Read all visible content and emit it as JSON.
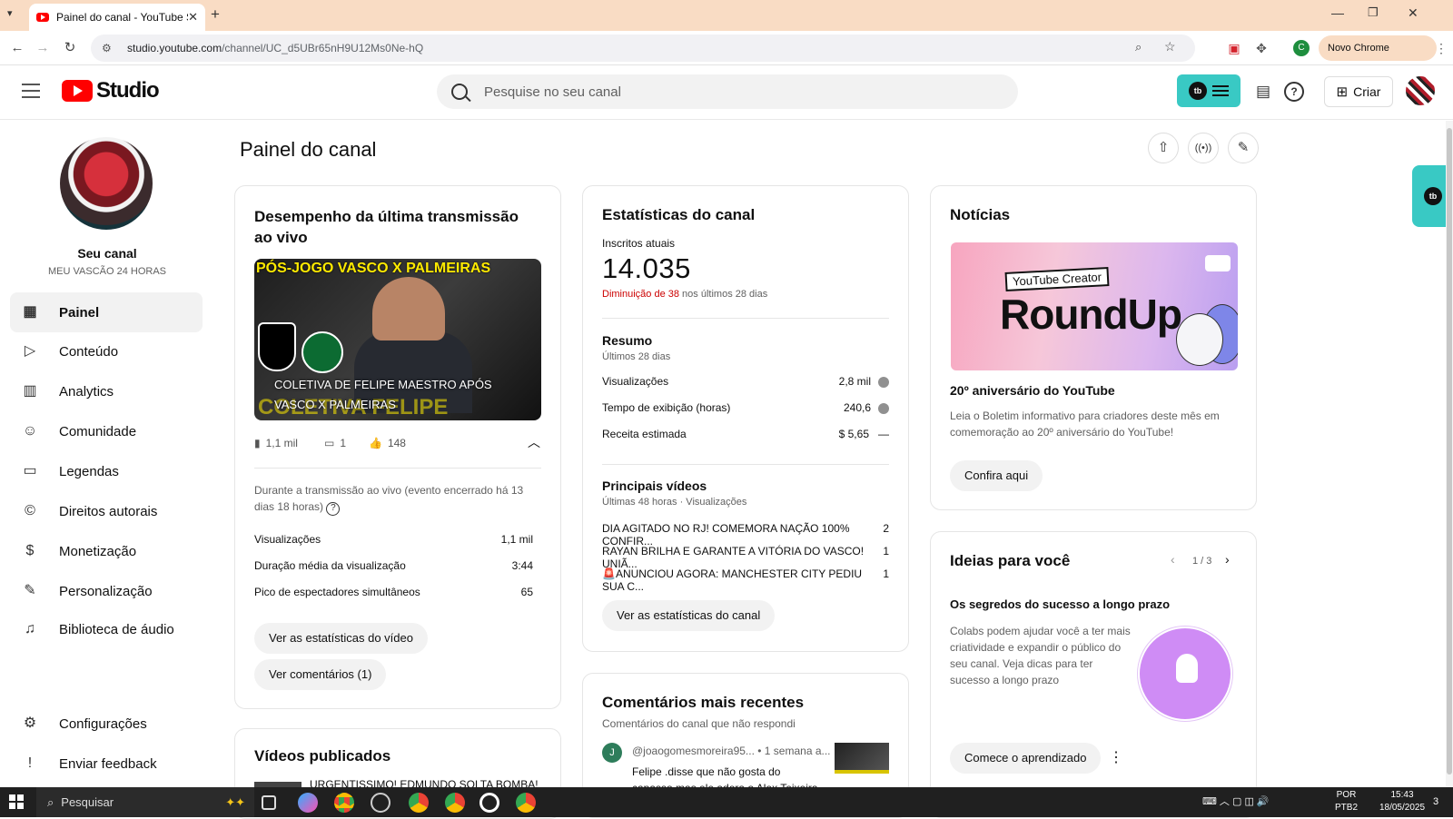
{
  "browser": {
    "tab_title": "Painel do canal - YouTube Studio",
    "url_main": "studio.youtube.com",
    "url_path": "/channel/UC_d5UBr65nH9U12Ms0Ne-hQ",
    "update_label": "Novo Chrome disponível",
    "profile_initial": "C"
  },
  "header": {
    "logo_text": "Studio",
    "search_placeholder": "Pesquise no seu canal",
    "create_label": "Criar"
  },
  "sidebar": {
    "channel_name": "Seu canal",
    "channel_handle": "MEU VASCÃO 24 HORAS",
    "items": [
      {
        "label": "Painel",
        "icon": "dashboard-icon"
      },
      {
        "label": "Conteúdo",
        "icon": "content-icon"
      },
      {
        "label": "Analytics",
        "icon": "analytics-icon"
      },
      {
        "label": "Comunidade",
        "icon": "community-icon"
      },
      {
        "label": "Legendas",
        "icon": "subtitles-icon"
      },
      {
        "label": "Direitos autorais",
        "icon": "copyright-icon"
      },
      {
        "label": "Monetização",
        "icon": "dollar-icon"
      },
      {
        "label": "Personalização",
        "icon": "magic-wand-icon"
      },
      {
        "label": "Biblioteca de áudio",
        "icon": "audio-library-icon"
      }
    ],
    "settings_label": "Configurações",
    "feedback_label": "Enviar feedback"
  },
  "main": {
    "title": "Painel do canal",
    "live": {
      "title": "Desempenho da última transmissão ao vivo",
      "thumb_top": "PÓS-JOGO VASCO X PALMEIRAS",
      "thumb_caption": "COLETIVA DE FELIPE MAESTRO APÓS VASCO X PALMEIRAS",
      "thumb_bottom": "COLETIVA FELIPE MAESTRO",
      "views_short": "1,1 mil",
      "comments_short": "1",
      "likes": "148",
      "note": "Durante a transmissão ao vivo (evento encerrado há 13 dias 18 horas)",
      "metrics": [
        {
          "label": "Visualizações",
          "value": "1,1 mil"
        },
        {
          "label": "Duração média da visualização",
          "value": "3:44"
        },
        {
          "label": "Pico de espectadores simultâneos",
          "value": "65"
        }
      ],
      "btn_stats": "Ver as estatísticas do vídeo",
      "btn_comments": "Ver comentários (1)"
    },
    "published": {
      "title": "Vídeos publicados",
      "first_item": "URGENTISSIMO! EDMUNDO SOLTA BOMBA!"
    },
    "stats": {
      "title": "Estatísticas do canal",
      "subs_label": "Inscritos atuais",
      "subs_value": "14.035",
      "change_neg": "Diminuição de 38",
      "change_rest": " nos últimos 28 dias",
      "summary_title": "Resumo",
      "summary_sub": "Últimos 28 dias",
      "summary": [
        {
          "label": "Visualizações",
          "value": "2,8 mil",
          "trend": "down"
        },
        {
          "label": "Tempo de exibição (horas)",
          "value": "240,6",
          "trend": "down"
        },
        {
          "label": "Receita estimada",
          "value": "$ 5,65",
          "trend": "flat"
        }
      ],
      "top_title": "Principais vídeos",
      "top_sub": "Últimas 48 horas · Visualizações",
      "top": [
        {
          "title": "DIA AGITADO NO RJ! COMEMORA NAÇÃO 100% CONFIR...",
          "views": "2"
        },
        {
          "title": "RAYAN BRILHA E GARANTE A VITÓRIA DO VASCO! UNIÃ...",
          "views": "1"
        },
        {
          "title": "🚨ANUNCIOU AGORA: MANCHESTER CITY PEDIU SUA C...",
          "views": "1"
        }
      ],
      "btn": "Ver as estatísticas do canal"
    },
    "comments": {
      "title": "Comentários mais recentes",
      "sub": "Comentários do canal que não respondi",
      "author": "@joaogomesmoreira95...",
      "time": "• 1 semana a...",
      "initial": "J",
      "text": "Felipe .disse que não gosta do capasso mas ele adora o Alex Teixeira, porque u..."
    },
    "news": {
      "title": "Notícias",
      "img_tag": "YouTube Creator",
      "img_word": "RoundUp",
      "headline": "20º aniversário do YouTube",
      "body": "Leia o Boletim informativo para criadores deste mês em comemoração ao 20º aniversário do YouTube!",
      "btn": "Confira aqui"
    },
    "ideas": {
      "title": "Ideias para você",
      "pager": "1 / 3",
      "headline": "Os segredos do sucesso a longo prazo",
      "body": "Colabs podem ajudar você a ter mais criatividade e expandir o público do seu canal. Veja dicas para ter sucesso a longo prazo",
      "btn": "Comece o aprendizado"
    }
  },
  "taskbar": {
    "search_label": "Pesquisar",
    "lang": "POR",
    "kbd": "PTB2",
    "time": "15:43",
    "date": "18/05/2025",
    "notif": "3"
  },
  "colors": {
    "accent": "#39c9c4",
    "brand": "#ff0000",
    "negative": "#cc0000",
    "tab_bar": "#f9dcc4"
  }
}
